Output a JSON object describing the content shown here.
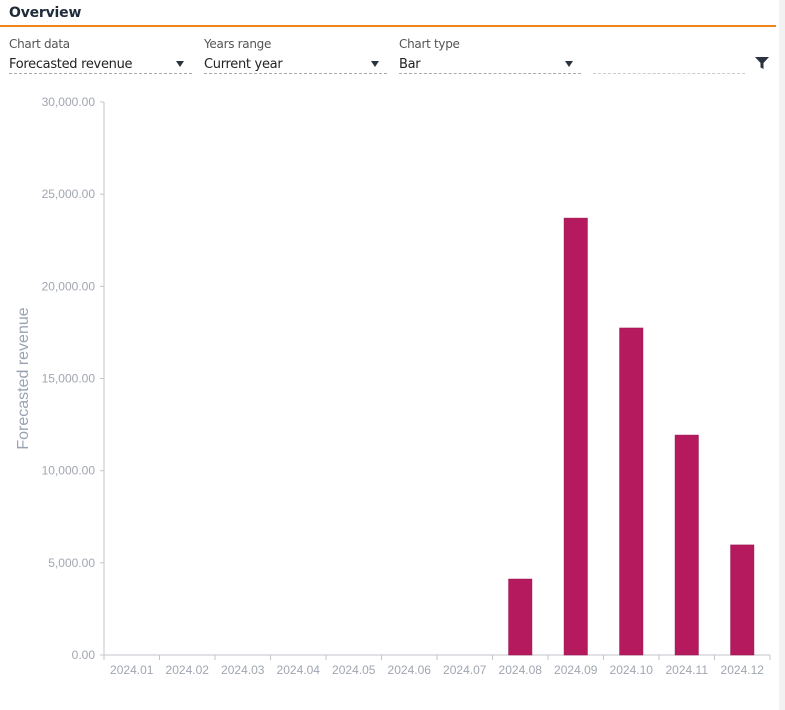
{
  "header": {
    "title": "Overview"
  },
  "controls": {
    "chart_data": {
      "label": "Chart data",
      "value": "Forecasted revenue"
    },
    "years_range": {
      "label": "Years range",
      "value": "Current year"
    },
    "chart_type": {
      "label": "Chart type",
      "value": "Bar"
    },
    "extra_field_value": "",
    "filter_icon": "filter-icon"
  },
  "colors": {
    "accent": "#f08418",
    "bar": "#b5195e"
  },
  "chart_data": {
    "type": "bar",
    "title": "",
    "xlabel": "",
    "ylabel": "Forecasted revenue",
    "ylim": [
      0,
      30000
    ],
    "yticks": [
      0,
      5000,
      10000,
      15000,
      20000,
      25000,
      30000
    ],
    "ytick_labels": [
      "0.00",
      "5,000.00",
      "10,000.00",
      "15,000.00",
      "20,000.00",
      "25,000.00",
      "30,000.00"
    ],
    "categories": [
      "2024.01",
      "2024.02",
      "2024.03",
      "2024.04",
      "2024.05",
      "2024.06",
      "2024.07",
      "2024.08",
      "2024.09",
      "2024.10",
      "2024.11",
      "2024.12"
    ],
    "values": [
      0,
      0,
      0,
      0,
      0,
      0,
      0,
      4120,
      23700,
      17740,
      11930,
      5970
    ],
    "grid": false,
    "legend": "none"
  }
}
